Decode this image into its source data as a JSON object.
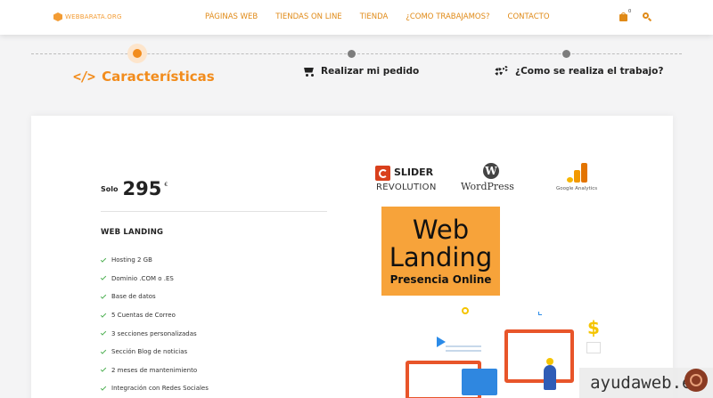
{
  "brand": {
    "logo_text": "WEBBARATA.ORG",
    "accent": "#f28c1c"
  },
  "nav": {
    "items": [
      "PÁGINAS WEB",
      "TIENDAS ON LINE",
      "TIENDA",
      "¿COMO TRABAJAMOS?",
      "CONTACTO"
    ]
  },
  "cart": {
    "count": "0",
    "icon": "shopping-bag-icon"
  },
  "search": {
    "icon": "search-icon"
  },
  "steps": [
    {
      "label": "Características",
      "icon": "code-icon",
      "active": true
    },
    {
      "label": "Realizar mi pedido",
      "icon": "cart-icon",
      "active": false
    },
    {
      "label": "¿Como se realiza el trabajo?",
      "icon": "gears-icon",
      "active": false
    }
  ],
  "plan": {
    "price_prefix": "Solo",
    "price": "295",
    "currency": "€",
    "title": "WEB LANDING",
    "features": [
      "Hosting 2 GB",
      "Dominio .COM o .ES",
      "Base de datos",
      "5 Cuentas de Correo",
      "3 secciones personalizadas",
      "Sección Blog de noticias",
      "2 meses de mantenimiento",
      "Integración con Redes Sociales"
    ]
  },
  "logos": {
    "slider_line1": "SLIDER",
    "slider_line2": "REVOLUTION",
    "wordpress": "WordPress",
    "ga": "Google Analytics"
  },
  "banner": {
    "line1": "Web",
    "line2": "Landing",
    "line3": "Presencia Online"
  },
  "illustration": {
    "dollar": "$"
  },
  "watermark": "ayudaweb.es"
}
